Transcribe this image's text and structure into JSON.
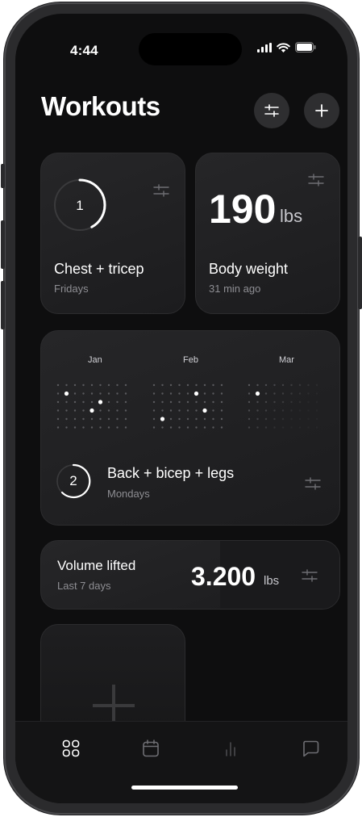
{
  "status": {
    "time": "4:44"
  },
  "header": {
    "title": "Workouts"
  },
  "workout1": {
    "number": "1",
    "title": "Chest + tricep",
    "subtitle": "Fridays",
    "progress": 0.42
  },
  "body_weight": {
    "value": "190",
    "unit": "lbs",
    "title": "Body weight",
    "subtitle": "31 min ago"
  },
  "calendar": {
    "months": [
      "Jan",
      "Feb",
      "Mar"
    ]
  },
  "workout2": {
    "number": "2",
    "title": "Back + bicep + legs",
    "subtitle": "Mondays"
  },
  "volume": {
    "title": "Volume lifted",
    "subtitle": "Last 7 days",
    "value": "3.200",
    "unit": "lbs"
  },
  "tabs": [
    {
      "icon": "grid-icon",
      "active": true
    },
    {
      "icon": "calendar-icon",
      "active": false
    },
    {
      "icon": "bar-chart-icon",
      "active": false
    },
    {
      "icon": "chat-icon",
      "active": false
    }
  ],
  "colors": {
    "background": "#0e0e0f",
    "card": "#232325",
    "accent": "#ffffff",
    "muted": "#8e8e93"
  }
}
